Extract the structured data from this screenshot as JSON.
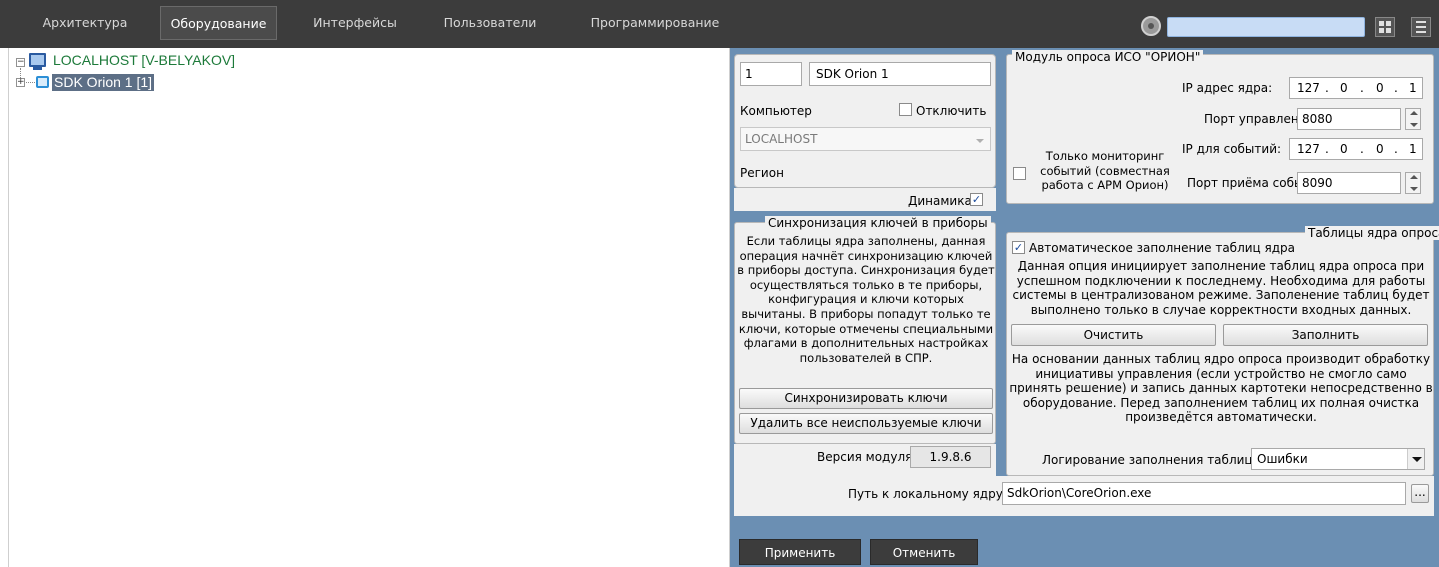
{
  "topbar": {
    "tabs": [
      "Архитектура",
      "Оборудование",
      "Интерфейсы",
      "Пользователи",
      "Программирование"
    ],
    "active_tab": "Оборудование",
    "search_value": ""
  },
  "tree": {
    "root": "LOCALHOST [V-BELYAKOV]",
    "child": "SDK Orion 1 [1]"
  },
  "device": {
    "id": "1",
    "name": "SDK Orion 1",
    "computer_label": "Компьютер",
    "disable_label": "Отключить",
    "computer_value": "LOCALHOST",
    "region_label": "Регион",
    "dynamics_label": "Динамика",
    "dynamics_checked": "✓"
  },
  "orion_module": {
    "title": "Модуль опроса ИСО \"ОРИОН\"",
    "ip_core_label": "IP адрес ядра:",
    "ip_core": [
      "127",
      "0",
      "0",
      "1"
    ],
    "control_port_label": "Порт управления:",
    "control_port": "8080",
    "ip_events_label": "IP для событий:",
    "ip_events": [
      "127",
      "0",
      "0",
      "1"
    ],
    "events_port_label": "Порт приёма событий:",
    "events_port": "8090",
    "monitoring_only_label": "Только мониторинг событий (совместная работа с АРМ Орион)"
  },
  "sync_keys": {
    "title": "Синхронизация ключей в приборы",
    "description": "Если таблицы ядра заполнены, данная операция начнёт синхронизацию ключей в приборы доступа. Синхронизация будет осуществляться только в те приборы, конфигурация и ключи которых вычитаны. В приборы попадут только те ключи, которые отмечены специальными флагами в дополнительных настройках пользователей в СПР.",
    "sync_button": "Синхронизировать ключи",
    "delete_unused_button": "Удалить все неиспользуемые ключи",
    "version_label": "Версия модуля",
    "version_value": "1.9.8.6"
  },
  "core_tables": {
    "title": "Таблицы ядра опроса",
    "auto_fill_label": "Автоматическое заполнение таблиц ядра",
    "auto_fill_checked": "✓",
    "description1": "Данная опция инициирует заполнение таблиц ядра опроса при успешном подключении к последнему. Необходима для работы системы в централизованом режиме. Заполенение таблиц будет выполнено только в случае корректности входных данных.",
    "clear_button": "Очистить",
    "fill_button": "Заполнить",
    "description2": "На основании данных таблиц ядро опроса производит обработку инициативы управления (если устройство не смогло само принять решение) и запись данных картотеки непосредственно в оборудование. Перед заполнением таблиц их полная очистка произведётся автоматически.",
    "logging_label": "Логирование заполнения таблиц:",
    "logging_value": "Ошибки"
  },
  "local_core": {
    "label": "Путь к локальному ядру:",
    "value": "SdkOrion\\CoreOrion.exe",
    "browse_button": "..."
  },
  "footer": {
    "apply_button": "Применить",
    "cancel_button": "Отменить"
  }
}
